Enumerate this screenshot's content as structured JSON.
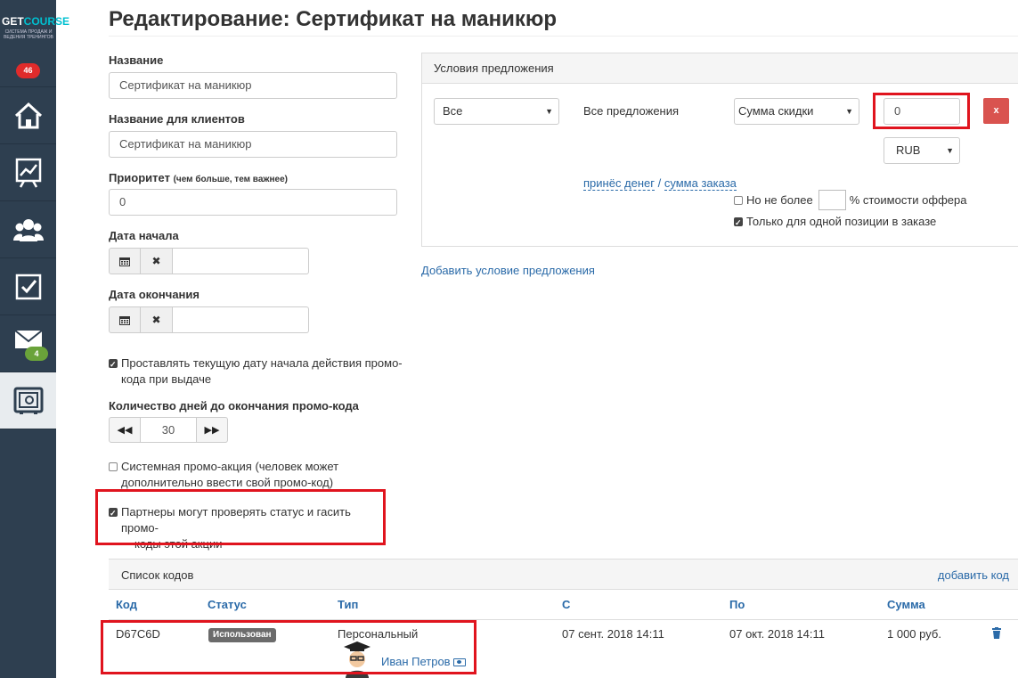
{
  "logo": {
    "brand_a": "GET",
    "brand_b": "COURSE",
    "tagline": "СИСТЕМА ПРОДАЖ И ВЕДЕНИЯ ТРЕНИНГОВ"
  },
  "sidebar": {
    "notifications": "46",
    "items": [
      {
        "icon": "home-icon"
      },
      {
        "icon": "chart-icon"
      },
      {
        "icon": "users-icon"
      },
      {
        "icon": "tasks-icon"
      },
      {
        "icon": "mail-icon",
        "badge": "4"
      },
      {
        "icon": "safe-icon",
        "active": true
      }
    ]
  },
  "page": {
    "title": "Редактирование: Сертификат на маникюр"
  },
  "form": {
    "name_label": "Название",
    "name_value": "Сертификат на маникюр",
    "client_name_label": "Название для клиентов",
    "client_name_value": "Сертификат на маникюр",
    "priority_label": "Приоритет",
    "priority_hint": "(чем больше, тем важнее)",
    "priority_value": "0",
    "start_date_label": "Дата начала",
    "end_date_label": "Дата окончания",
    "set_start_date_line1": "Проставлять текущую дату начала действия промо-",
    "set_start_date_line2": "кода при выдаче",
    "days_label": "Количество дней до окончания промо-кода",
    "days_value": "30",
    "system_promo_line1": "Системная промо-акция (человек может",
    "system_promo_line2": "дополнительно ввести свой промо-код)",
    "partners_line1": "Партнеры могут проверять статус и гасить промо-",
    "partners_line2": "коды этой акции"
  },
  "conditions": {
    "header": "Условия предложения",
    "scope_select": "Все",
    "offers_text": "Все предложения",
    "discount_type_select": "Сумма скидки",
    "discount_value": "0",
    "remove_label": "x",
    "currency_select": "RUB",
    "link_text_a": "принёс денег",
    "link_sep": " / ",
    "link_text_b": "сумма заказа",
    "no_more_than": "Но не более",
    "percent_text": "% стоимости оффера",
    "single_position": "Только для одной позиции в заказе",
    "add_condition": "Добавить условие предложения"
  },
  "codes": {
    "header": "Список кодов",
    "add_code": "добавить код",
    "columns": [
      "Код",
      "Статус",
      "Тип",
      "С",
      "По",
      "Сумма"
    ],
    "rows": [
      {
        "code": "D67C6D",
        "status": "Использован",
        "type": "Персональный",
        "user": "Иван Петров",
        "from": "07 сент. 2018 14:11",
        "to": "07 окт. 2018 14:11",
        "sum": "1 000 руб."
      }
    ]
  },
  "colors": {
    "sidebar": "#2e3f50",
    "accent_link": "#2a6aa8",
    "danger": "#d9534f",
    "highlight": "#e0141e"
  }
}
